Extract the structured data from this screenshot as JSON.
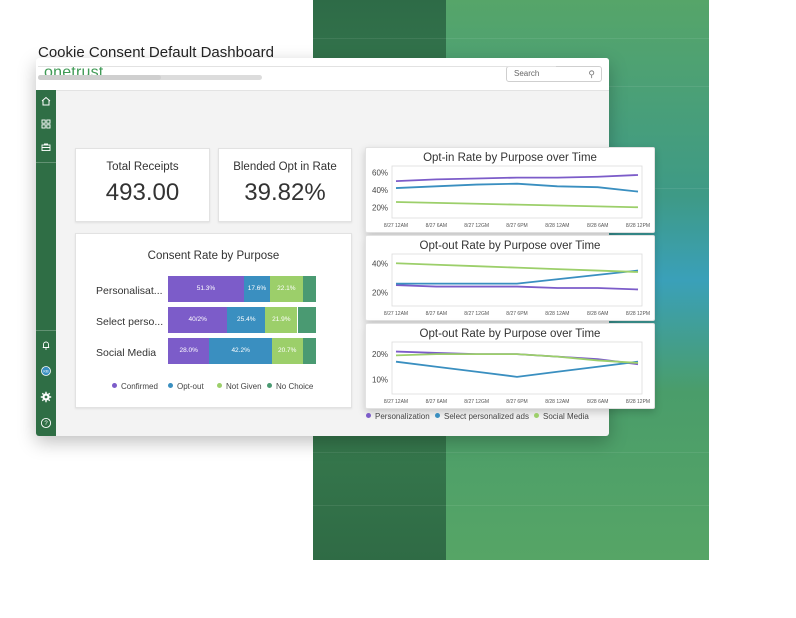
{
  "brand": {
    "logo": "onetrust"
  },
  "search": {
    "placeholder": "Search"
  },
  "icons": [
    "home-icon",
    "grid-icon",
    "briefcase-icon",
    "bell-icon",
    "user-badge-icon",
    "gear-icon",
    "help-icon"
  ],
  "page": {
    "title": "Cookie Consent Default Dashboard",
    "loading_progress": 0.55
  },
  "kpis": [
    {
      "label": "Total Receipts",
      "value": "493.00"
    },
    {
      "label": "Blended Opt in Rate",
      "value": "39.82%"
    }
  ],
  "colors": {
    "confirmed": "#7c5cc9",
    "opt_out": "#3a8fc0",
    "not_given": "#9ccf6a",
    "no_choice": "#4a9a72",
    "personalization": "#7c5cc9",
    "select_ads": "#3a8fc0",
    "social_media": "#9ccf6a"
  },
  "chart_data": [
    {
      "type": "bar",
      "title": "Consent Rate by Purpose",
      "categories": [
        "Personalisat...",
        "Select perso...",
        "Social Media"
      ],
      "series": [
        {
          "name": "Confirmed",
          "values": [
            51.3,
            40.2,
            28.0
          ],
          "labels": [
            "51.3%",
            "40/2%",
            "28.0%"
          ]
        },
        {
          "name": "Opt-out",
          "values": [
            17.6,
            25.4,
            42.2
          ],
          "labels": [
            "17.6%",
            "25.4%",
            "42.2%"
          ]
        },
        {
          "name": "Not Given",
          "values": [
            22.1,
            21.9,
            20.7
          ],
          "labels": [
            "22.1%",
            "21.9%",
            "20.7%"
          ]
        },
        {
          "name": "No Choice",
          "values": [
            9.0,
            12.5,
            9.1
          ],
          "labels": [
            "",
            "",
            ""
          ]
        }
      ]
    },
    {
      "type": "line",
      "title": "Opt-in Rate by Purpose over Time",
      "x": [
        "8/27 12AM",
        "8/27 6AM",
        "8/27 12GM",
        "8/27 6PM",
        "8/28 12AM",
        "8/28 6AM",
        "8/28 12PM"
      ],
      "y_ticks": [
        "20%",
        "40%",
        "60%"
      ],
      "ylim": [
        10,
        65
      ],
      "series": [
        {
          "name": "Personalization",
          "values": [
            50,
            52,
            53,
            54,
            54,
            55,
            57
          ]
        },
        {
          "name": "Select personalized ads",
          "values": [
            42,
            44,
            46,
            47,
            44,
            43,
            38
          ]
        },
        {
          "name": "Social Media",
          "values": [
            26,
            25,
            24,
            23,
            22,
            21,
            20
          ]
        }
      ]
    },
    {
      "type": "line",
      "title": "Opt-out Rate by Purpose over Time",
      "x": [
        "8/27 12AM",
        "8/27 6AM",
        "8/27 12GM",
        "8/27 6PM",
        "8/28 12AM",
        "8/28 6AM",
        "8/28 12PM"
      ],
      "y_ticks": [
        "20%",
        "40%"
      ],
      "ylim": [
        12,
        45
      ],
      "series": [
        {
          "name": "Personalization",
          "values": [
            25,
            24,
            24,
            24,
            23,
            23,
            22
          ]
        },
        {
          "name": "Select personalized ads",
          "values": [
            26,
            26,
            26,
            26,
            29,
            32,
            35
          ]
        },
        {
          "name": "Social Media",
          "values": [
            40,
            39,
            38,
            37,
            36,
            35,
            34
          ]
        }
      ]
    },
    {
      "type": "line",
      "title": "Opt-out Rate by Purpose over Time",
      "x": [
        "8/27 12AM",
        "8/27 6AM",
        "8/27 12GM",
        "8/27 6PM",
        "8/28 12AM",
        "8/28 6AM",
        "8/28 12PM"
      ],
      "y_ticks": [
        "10%",
        "20%"
      ],
      "ylim": [
        5,
        24
      ],
      "series": [
        {
          "name": "Personalization",
          "values": [
            21,
            20.5,
            20,
            20,
            19,
            18,
            16
          ]
        },
        {
          "name": "Select personalized ads",
          "values": [
            17,
            15,
            13,
            11,
            13,
            15,
            17
          ]
        },
        {
          "name": "Social Media",
          "values": [
            19.5,
            20,
            20,
            20,
            19,
            17.5,
            16.5
          ]
        }
      ]
    }
  ],
  "bars_legend": [
    "Confirmed",
    "Opt-out",
    "Not Given",
    "No Choice"
  ],
  "lines_legend": [
    "Personalization",
    "Select personalized ads",
    "Social Media"
  ]
}
